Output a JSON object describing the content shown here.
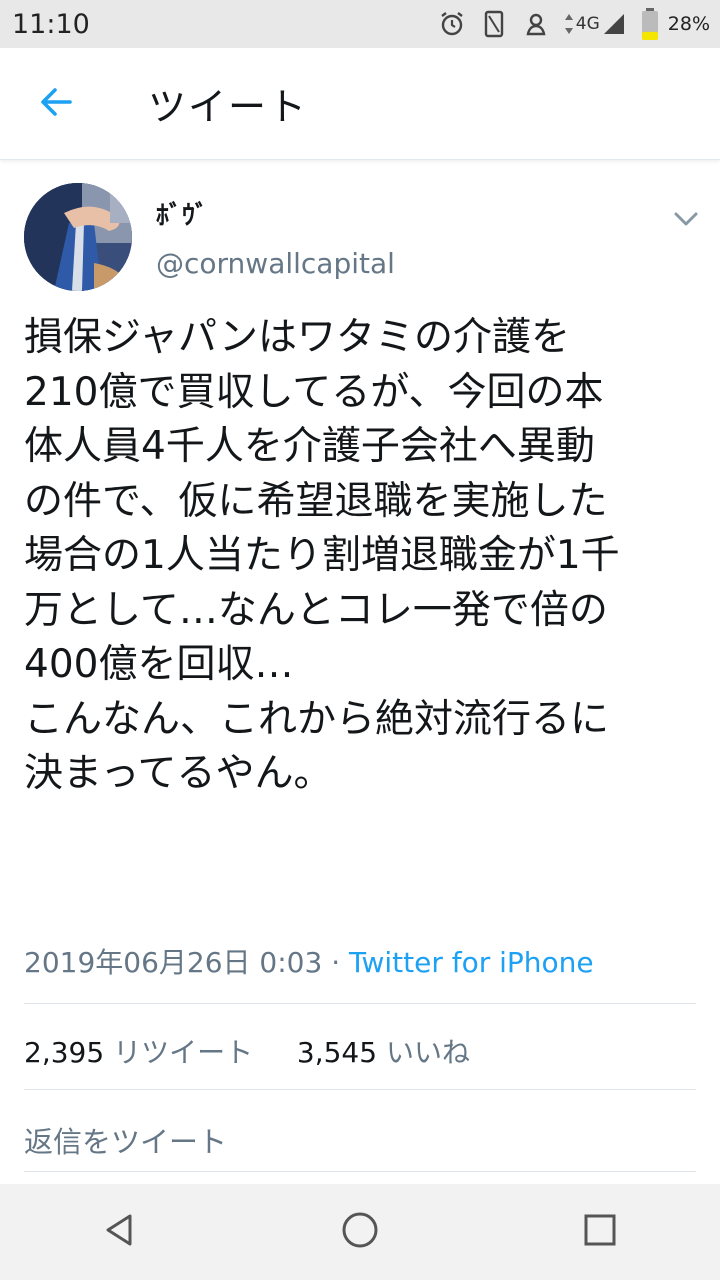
{
  "status_bar": {
    "time": "11:10",
    "network": "4G",
    "battery_percent": "28%",
    "battery_level": 0.28,
    "icons": [
      "alarm-icon",
      "vibrate-icon",
      "hotspot-icon",
      "data-arrows-icon",
      "signal-icon",
      "battery-icon"
    ]
  },
  "app_bar": {
    "title": "ツイート",
    "back_icon": "arrow-left-icon"
  },
  "tweet": {
    "display_name": "ﾎﾞｳﾞ",
    "handle": "@cornwallcapital",
    "text": "損保ジャパンはワタミの介護を\n210億で買収してるが、今回の本\n体人員4千人を介護子会社へ異動\nの件で、仮に希望退職を実施した\n場合の1人当たり割増退職金が1千\n万として…なんとコレ一発で倍の\n400億を回収…\nこんなん、これから絶対流行るに\n決まってるやん。",
    "date": "2019年06月26日 0:03",
    "separator": " · ",
    "source": "Twitter for iPhone",
    "retweets_count": "2,395",
    "retweets_label": "リツイート",
    "likes_count": "3,545",
    "likes_label": "いいね",
    "reply_placeholder": "返信をツイート"
  },
  "colors": {
    "accent": "#1da1f2",
    "secondary_text": "#657786",
    "primary_text": "#14171a"
  },
  "nav_bar": {
    "buttons": [
      "back-triangle-icon",
      "home-circle-icon",
      "recents-square-icon"
    ]
  }
}
